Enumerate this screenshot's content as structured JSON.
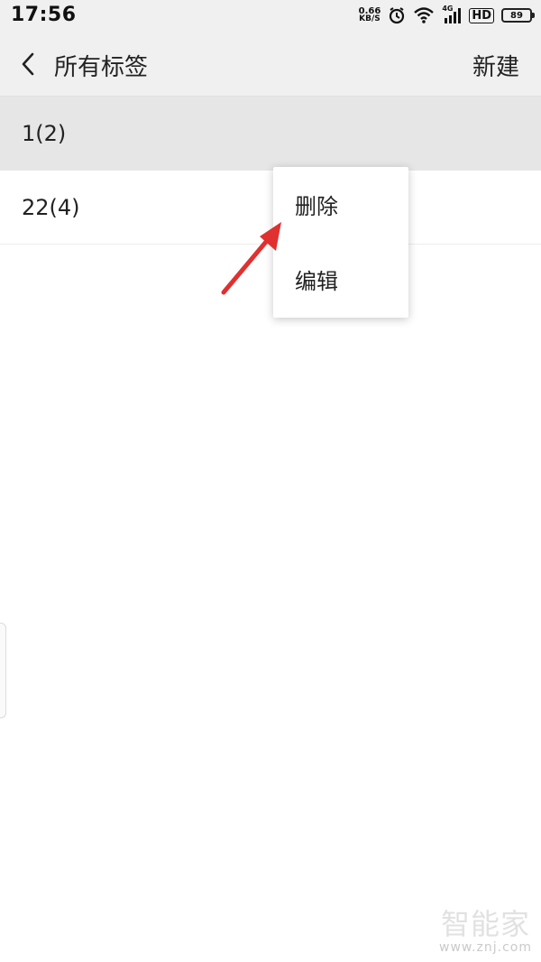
{
  "status_bar": {
    "time": "17:56",
    "net_speed_value": "0.66",
    "net_speed_unit": "KB/S",
    "network_type": "4G",
    "hd_label": "HD",
    "battery_level": "89"
  },
  "header": {
    "title": "所有标签",
    "new_label": "新建"
  },
  "tags": [
    {
      "label": "1(2)"
    },
    {
      "label": "22(4)"
    }
  ],
  "context_menu": {
    "items": [
      {
        "label": "删除"
      },
      {
        "label": "编辑"
      }
    ]
  },
  "watermark": {
    "logo_text": "智能家",
    "url": "www.znj.com"
  },
  "colors": {
    "header_bg": "#f0f0f0",
    "selected_row_bg": "#e6e6e6",
    "annotation_arrow": "#e03030"
  }
}
